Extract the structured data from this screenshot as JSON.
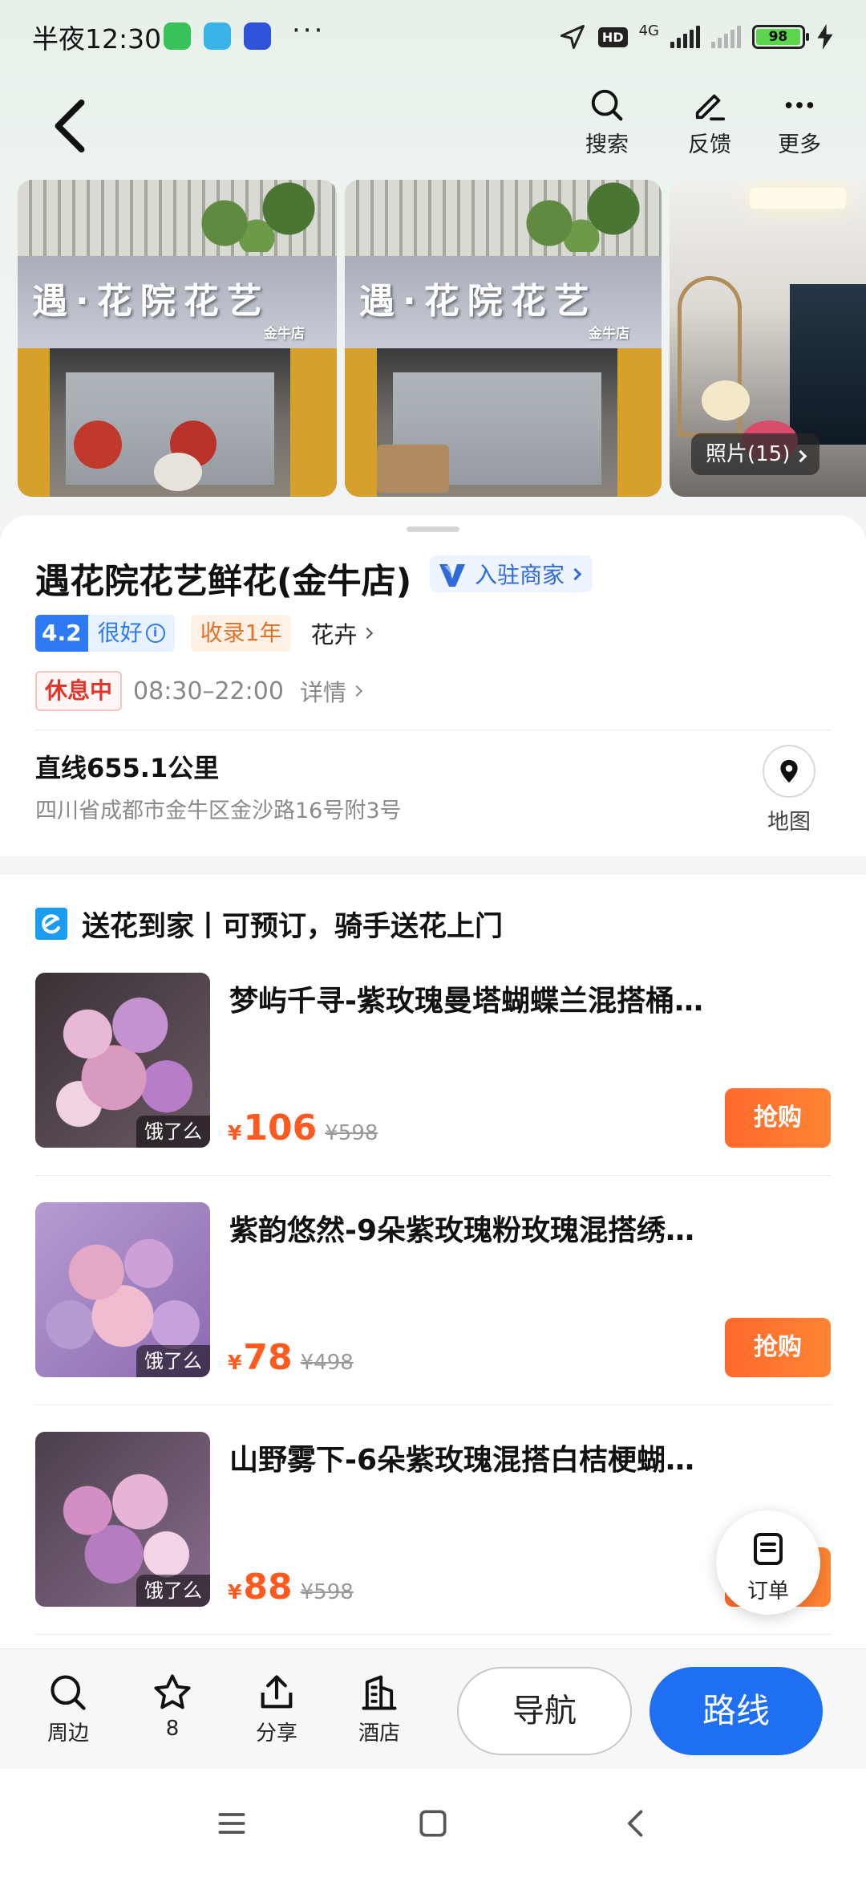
{
  "status_bar": {
    "time": "半夜12:30",
    "more": "···",
    "hd": "HD",
    "network": "4G",
    "battery": "98",
    "battery_level": 0.98
  },
  "nav": {
    "search_label": "搜索",
    "feedback_label": "反馈",
    "more_label": "更多"
  },
  "photos": {
    "sign_text": "遇·花院花艺",
    "sign_sub": "金牛店",
    "count_label": "照片(15)"
  },
  "shop": {
    "name": "遇花院花艺鲜花(金牛店)",
    "merchant_badge": "入驻商家",
    "rating": "4.2",
    "rating_text": "很好",
    "info_icon": "i",
    "listed_tag": "收录1年",
    "category": "花卉",
    "status": "休息中",
    "hours": "08:30–22:00",
    "hours_detail": "详情",
    "distance": "直线655.1公里",
    "address": "四川省成都市金牛区金沙路16号附3号",
    "map_label": "地图"
  },
  "delivery": {
    "title": "送花到家丨可预订，骑手送花上门",
    "products": [
      {
        "title": "梦屿千寻-紫玫瑰曼塔蝴蝶兰混搭桶…",
        "tag": "饿了么",
        "currency": "¥",
        "price": "106",
        "original_price": "¥598",
        "buy_label": "抢购"
      },
      {
        "title": "紫韵悠然-9朵紫玫瑰粉玫瑰混搭绣…",
        "tag": "饿了么",
        "currency": "¥",
        "price": "78",
        "original_price": "¥498",
        "buy_label": "抢购"
      },
      {
        "title": "山野雾下-6朵紫玫瑰混搭白桔梗蝴…",
        "tag": "饿了么",
        "currency": "¥",
        "price": "88",
        "original_price": "¥598",
        "buy_label": "抢购"
      }
    ]
  },
  "order_fab": {
    "label": "订单"
  },
  "toolbar": {
    "nearby": "周边",
    "favorites_count": "8",
    "share": "分享",
    "hotel": "酒店",
    "navigate": "导航",
    "route": "路线"
  },
  "colors": {
    "accent_blue": "#1f6ff2",
    "price_orange": "#ff5a1f",
    "closed_red": "#e0362b",
    "rating_blue": "#2e7af5"
  }
}
